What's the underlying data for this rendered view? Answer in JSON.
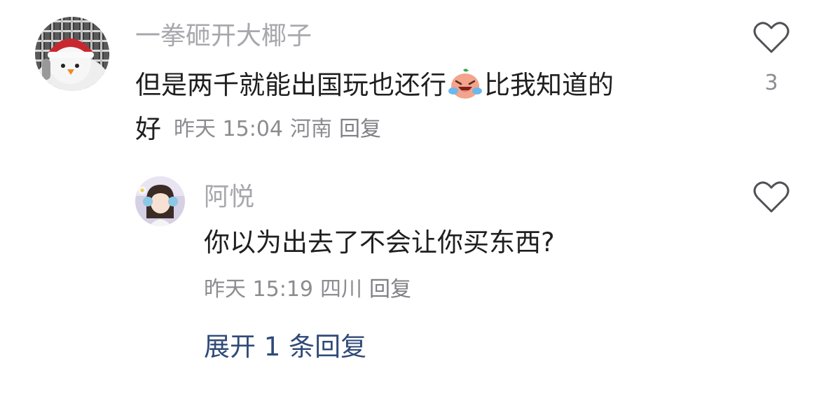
{
  "comments": [
    {
      "username": "一拳砸开大椰子",
      "text_before_emoji": "但是两千就能出国玩也还行",
      "emoji": "crying-laughing-face-emoji",
      "text_after_emoji": "比我知道的",
      "text_line2": "好",
      "time": "昨天 15:04",
      "location": "河南",
      "reply_label": "回复",
      "like_count": "3",
      "like_icon": "heart-outline-icon"
    },
    {
      "username": "阿悦",
      "text": "你以为出去了不会让你买东西?",
      "time": "昨天 15:19",
      "location": "四川",
      "reply_label": "回复",
      "like_icon": "heart-outline-icon"
    }
  ],
  "expand_replies_label": "展开 1 条回复",
  "colors": {
    "username": "#a7a7ac",
    "text": "#1f1f1f",
    "meta": "#8c8c91",
    "link": "#2f4a78"
  }
}
